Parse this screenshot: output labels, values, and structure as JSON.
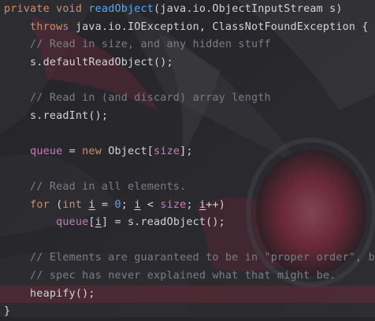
{
  "editor": {
    "language": "java",
    "colors": {
      "keyword": "#cf8e6d",
      "function": "#56a8f5",
      "comment": "#7a7e85",
      "field": "#c77dbb",
      "text": "#d2d4d8",
      "current_line": "#5a2a35"
    },
    "lines": [
      [
        {
          "t": "private ",
          "c": "kw"
        },
        {
          "t": "void ",
          "c": "kw"
        },
        {
          "t": "readObject",
          "c": "fn"
        },
        {
          "t": "(java.io.ObjectInputStream s)",
          "c": ""
        }
      ],
      [
        {
          "t": "    throws ",
          "c": "kw"
        },
        {
          "t": "java.io.IOException, ClassNotFoundException {",
          "c": ""
        }
      ],
      [
        {
          "t": "    // Read in size, and any hidden stuff",
          "c": "cm"
        }
      ],
      [
        {
          "t": "    s.defaultReadObject();",
          "c": ""
        }
      ],
      [],
      [
        {
          "t": "    // Read in (and discard) array length",
          "c": "cm"
        }
      ],
      [
        {
          "t": "    s.readInt();",
          "c": ""
        }
      ],
      [],
      [
        {
          "t": "    ",
          "c": ""
        },
        {
          "t": "queue",
          "c": "fld"
        },
        {
          "t": " = ",
          "c": ""
        },
        {
          "t": "new ",
          "c": "kw"
        },
        {
          "t": "Object[",
          "c": ""
        },
        {
          "t": "size",
          "c": "fld"
        },
        {
          "t": "];",
          "c": ""
        }
      ],
      [],
      [
        {
          "t": "    // Read in all elements.",
          "c": "cm"
        }
      ],
      [
        {
          "t": "    ",
          "c": ""
        },
        {
          "t": "for ",
          "c": "kw"
        },
        {
          "t": "(",
          "c": ""
        },
        {
          "t": "int ",
          "c": "kw"
        },
        {
          "t": "i",
          "c": "var"
        },
        {
          "t": " = ",
          "c": ""
        },
        {
          "t": "0",
          "c": "fn"
        },
        {
          "t": "; ",
          "c": ""
        },
        {
          "t": "i",
          "c": "var"
        },
        {
          "t": " < ",
          "c": ""
        },
        {
          "t": "size",
          "c": "fld"
        },
        {
          "t": "; ",
          "c": ""
        },
        {
          "t": "i",
          "c": "var"
        },
        {
          "t": "++)",
          "c": ""
        }
      ],
      [
        {
          "t": "        ",
          "c": ""
        },
        {
          "t": "queue",
          "c": "fld"
        },
        {
          "t": "[",
          "c": ""
        },
        {
          "t": "i",
          "c": "var"
        },
        {
          "t": "] = s.readObject();",
          "c": ""
        }
      ],
      [],
      [
        {
          "t": "    // Elements are guaranteed to be in \"proper order\", but",
          "c": "cm"
        }
      ],
      [
        {
          "t": "    // spec has never explained what that might be.",
          "c": "cm"
        }
      ],
      [
        {
          "t": "    heapify();",
          "c": ""
        }
      ],
      [
        {
          "t": "}",
          "c": ""
        }
      ]
    ],
    "current_line_index": 16
  }
}
